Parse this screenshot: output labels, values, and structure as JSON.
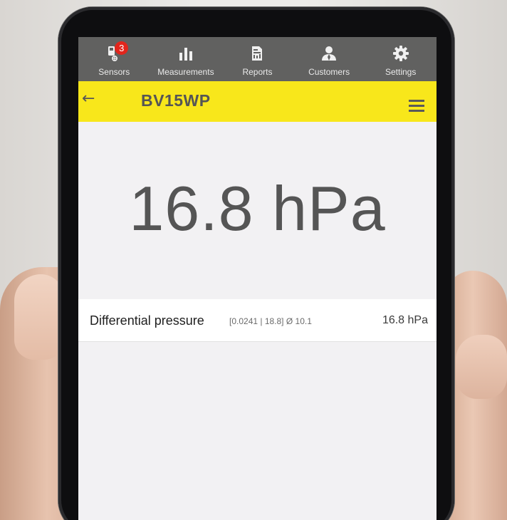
{
  "navbar": {
    "items": [
      {
        "label": "Sensors",
        "icon": "sensor-icon",
        "badge": "3"
      },
      {
        "label": "Measurements",
        "icon": "bar-chart-icon"
      },
      {
        "label": "Reports",
        "icon": "report-icon"
      },
      {
        "label": "Customers",
        "icon": "person-icon"
      },
      {
        "label": "Settings",
        "icon": "gear-icon"
      }
    ]
  },
  "header": {
    "title": "BV15WP",
    "back_icon": "arrow-left-icon",
    "menu_icon": "hamburger-menu-icon",
    "background": "#f8e71b"
  },
  "reading": {
    "value": "16.8 hPa"
  },
  "measurements": [
    {
      "label": "Differential pressure",
      "range": "[0.0241 | 18.8] Ø 10.1",
      "value": "16.8 hPa"
    }
  ],
  "colors": {
    "navbar": "#616160",
    "badge": "#e2251c",
    "screen_bg": "#f2f1f3"
  }
}
